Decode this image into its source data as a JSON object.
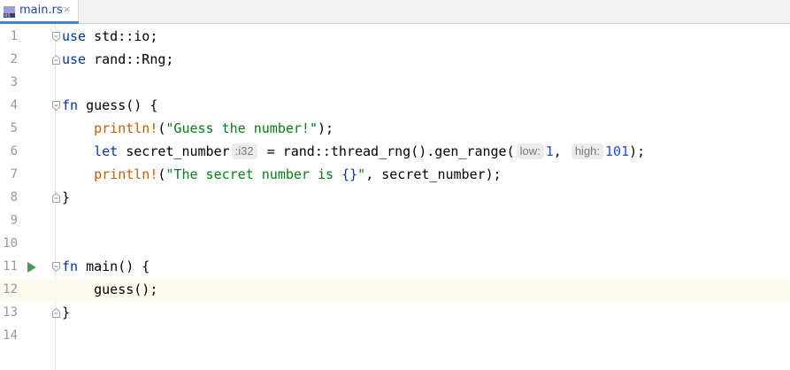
{
  "tab": {
    "label": "main.rs",
    "close": "×",
    "icon": "rust-file-icon"
  },
  "lines": [
    {
      "n": "1"
    },
    {
      "n": "2"
    },
    {
      "n": "3"
    },
    {
      "n": "4"
    },
    {
      "n": "5"
    },
    {
      "n": "6"
    },
    {
      "n": "7"
    },
    {
      "n": "8"
    },
    {
      "n": "9"
    },
    {
      "n": "10"
    },
    {
      "n": "11"
    },
    {
      "n": "12"
    },
    {
      "n": "13"
    },
    {
      "n": "14"
    }
  ],
  "code": {
    "l1": {
      "kw": "use",
      "rest": " std::io;"
    },
    "l2": {
      "kw": "use",
      "rest": " rand::Rng;"
    },
    "l4": {
      "kw": "fn",
      "rest": " guess() {"
    },
    "l5": {
      "indent": "    ",
      "mac": "println!",
      "p1": "(",
      "str": "\"Guess the number!\"",
      "p2": ");"
    },
    "l6": {
      "indent": "    ",
      "kw": "let",
      "var": " secret_number",
      "hint_type": ":i32",
      "mid": " = rand::thread_rng().gen_range(",
      "hint_low": "low:",
      "low": "1",
      "comma": ", ",
      "hint_high": "high:",
      "high": "101",
      "end": ");"
    },
    "l7": {
      "indent": "    ",
      "mac": "println!",
      "p1": "(",
      "str1": "\"The secret number is ",
      "braces": "{}",
      "str2": "\"",
      "rest": ", secret_number);"
    },
    "l8": {
      "text": "}"
    },
    "l11": {
      "kw": "fn",
      "rest": " main() {"
    },
    "l12": {
      "indent": "    ",
      "text": "guess();"
    },
    "l13": {
      "text": "}"
    }
  },
  "colors": {
    "keyword": "#0033b3",
    "macro": "#c65d09",
    "string": "#067d17",
    "number": "#1750eb",
    "current_line": "#fdfbee",
    "run_icon": "#499c54"
  }
}
